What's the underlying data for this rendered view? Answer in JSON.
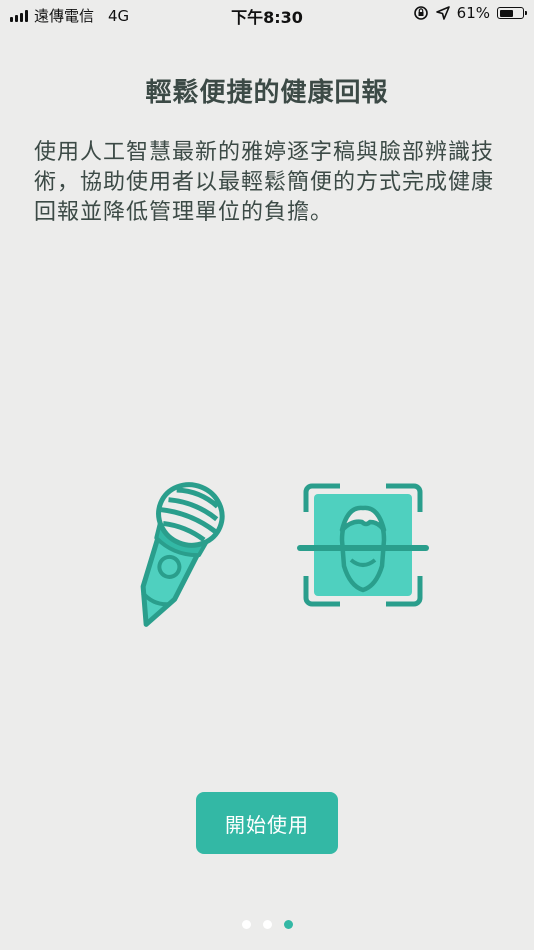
{
  "status_bar": {
    "carrier": "遠傳電信",
    "network": "4G",
    "time": "下午8:30",
    "battery_percent": "61%",
    "battery_level": 0.61,
    "icons": [
      "signal-icon",
      "orientation-lock-icon",
      "location-arrow-icon",
      "battery-icon"
    ]
  },
  "page": {
    "title": "輕鬆便捷的健康回報",
    "description": "使用人工智慧最新的雅婷逐字稿與臉部辨識技術，協助使用者以最輕鬆簡便的方式完成健康回報並降低管理單位的負擔。"
  },
  "illustration": {
    "icons": [
      "microphone-icon",
      "face-scan-icon"
    ],
    "colors": {
      "accent": "#33b8a5",
      "light": "#4fd0bf"
    }
  },
  "start_button": {
    "label": "開始使用"
  },
  "pager": {
    "total": 3,
    "active_index": 2
  },
  "colors": {
    "background": "#ececeb",
    "accent": "#33b8a5",
    "text": "#3c4a46"
  }
}
